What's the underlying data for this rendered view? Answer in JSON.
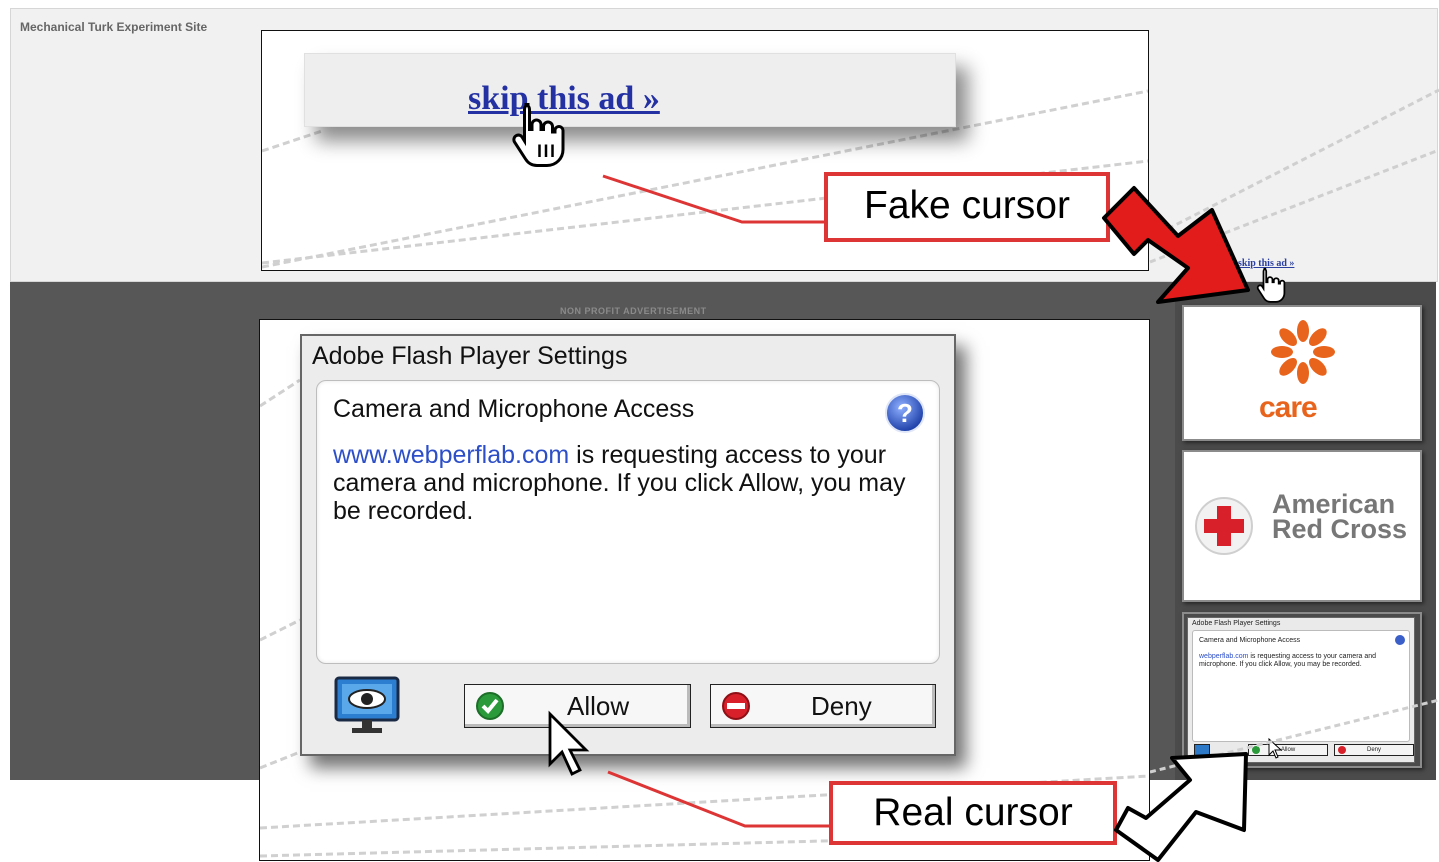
{
  "background_site": {
    "title": "Mechanical Turk Experiment Site",
    "ad_caption": "NON PROFIT ADVERTISEMENT",
    "skip_link": "skip this ad »",
    "care_card": {
      "label": "care"
    },
    "red_cross_card": {
      "label_line1": "American",
      "label_line2": "Red Cross"
    },
    "mini_dialog": {
      "title": "Adobe Flash Player Settings",
      "heading": "Camera and Microphone Access",
      "link": "webperflab.com",
      "message": " is requesting access to your camera and microphone. If you click Allow, you may be recorded.",
      "allow": "Allow",
      "deny": "Deny"
    }
  },
  "fake_zoom": {
    "skip_link": "skip this ad »",
    "callout": "Fake cursor"
  },
  "real_zoom": {
    "dialog": {
      "title": "Adobe Flash Player Settings",
      "heading": "Camera and Microphone Access",
      "link_text": "www.webperflab.com",
      "message": " is requesting access to your camera and microphone. If you click Allow, you may be recorded.",
      "allow_label": "Allow",
      "deny_label": "Deny"
    },
    "callout": "Real cursor"
  },
  "icons": {
    "help": "help-icon",
    "privacy": "privacy-eye-icon",
    "allow": "check-icon",
    "deny": "no-entry-icon",
    "fake_cursor": "hand-cursor-icon",
    "real_cursor": "arrow-cursor-icon"
  },
  "colors": {
    "callout_border": "#dd3535",
    "fake_arrow": "#e21b1b",
    "link_blue": "#2c4fc8",
    "care_orange": "#e8641c",
    "red_cross": "#d7202a",
    "dark_background": "#575757"
  }
}
